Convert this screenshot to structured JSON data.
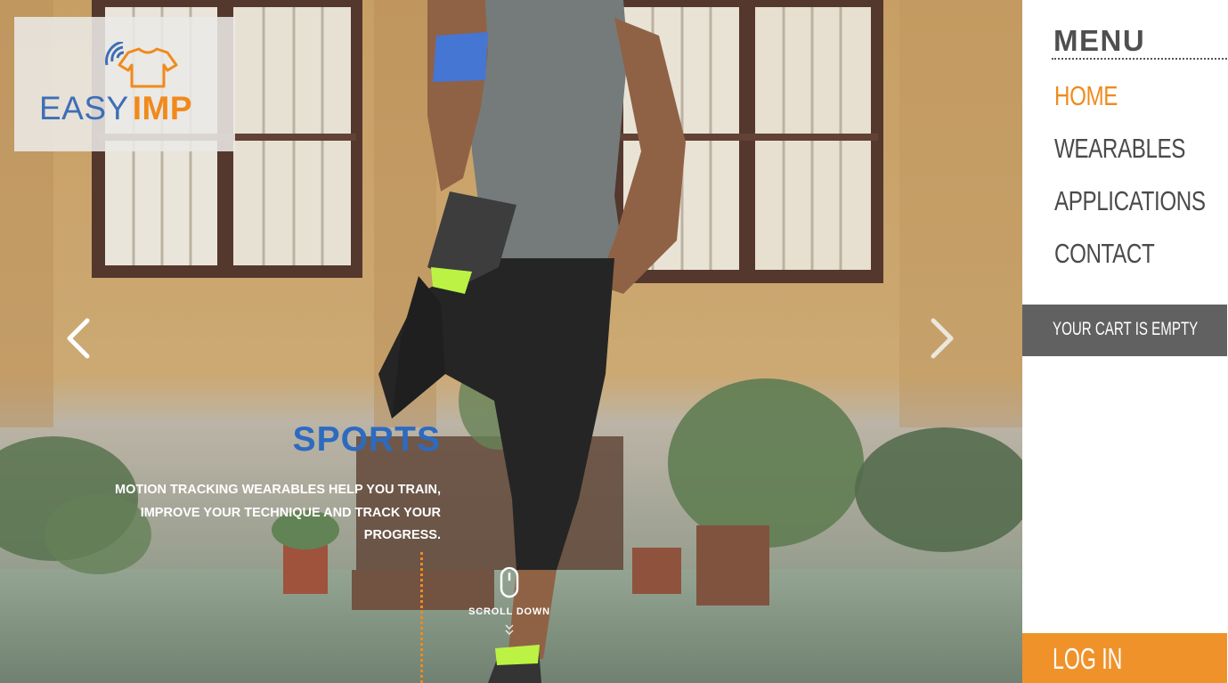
{
  "logo": {
    "word1": "EASY",
    "word2": "IMP",
    "icon": "t-shirt-wifi-icon",
    "color_easy": "#3d6eb8",
    "color_imp": "#f08a1c"
  },
  "slider": {
    "prev_icon": "chevron-left-icon",
    "next_icon": "chevron-right-icon",
    "title": "SPORTS",
    "description": "MOTION TRACKING WEARABLES HELP YOU TRAIN, IMPROVE YOUR TECHNIQUE AND TRACK YOUR PROGRESS.",
    "title_color": "#2d6bc0"
  },
  "scroll": {
    "label": "SCROLL DOWN",
    "icon": "mouse-icon",
    "chevrons_icon": "double-chevron-down-icon"
  },
  "menu": {
    "title": "MENU",
    "items": [
      {
        "label": "Home",
        "active": true
      },
      {
        "label": "Wearables",
        "active": false
      },
      {
        "label": "Applications",
        "active": false
      },
      {
        "label": "Contact",
        "active": false
      }
    ],
    "active_color": "#f08a1c"
  },
  "cart": {
    "status": "Your cart is empty"
  },
  "auth": {
    "login_label": "Log in",
    "color": "#f0922a"
  }
}
